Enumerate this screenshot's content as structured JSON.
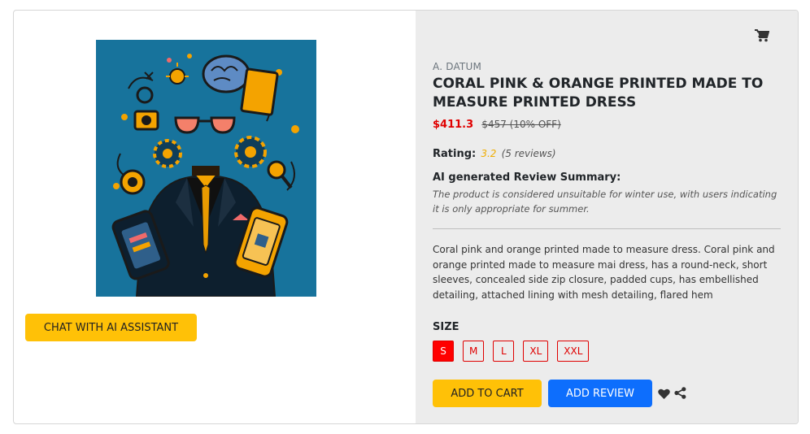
{
  "product": {
    "brand": "A. DATUM",
    "title": "CORAL PINK & ORANGE PRINTED MADE TO MEASURE PRINTED DRESS",
    "price": "$411.3",
    "original_price": "$457 (10% OFF)",
    "image_alt": "Illustration of a faceless figure in a dark suit and orange tie with sunglasses, surrounded by gadgets, gears and a brain on a blue background"
  },
  "rating": {
    "label": "Rating:",
    "value": "3.2",
    "count": "(5 reviews)"
  },
  "ai_summary": {
    "heading": "AI generated Review Summary:",
    "text": "The product is considered unsuitable for winter use, with users indicating it is only appropriate for summer."
  },
  "description": "Coral pink and orange printed made to measure dress. Coral pink and orange printed made to measure mai dress, has a round-neck, short sleeves, concealed side zip closure, padded cups, has embellished detailing, attached lining with mesh detailing, flared hem",
  "sizes": {
    "label": "SIZE",
    "options": [
      "S",
      "M",
      "L",
      "XL",
      "XXL"
    ],
    "selected": "S"
  },
  "actions": {
    "chat_label": "CHAT WITH AI ASSISTANT",
    "add_to_cart_label": "ADD TO CART",
    "add_review_label": "ADD REVIEW"
  },
  "icons": {
    "cart": "cart-icon",
    "wishlist": "heart-icon",
    "share": "share-icon"
  },
  "colors": {
    "accent_yellow": "#ffc107",
    "primary_blue": "#0d6efd",
    "price_red": "#e00000",
    "selected_size": "#ff0000",
    "rating_star": "#f0ad00",
    "panel_gray": "#ececec",
    "image_bg": "#17739c"
  }
}
